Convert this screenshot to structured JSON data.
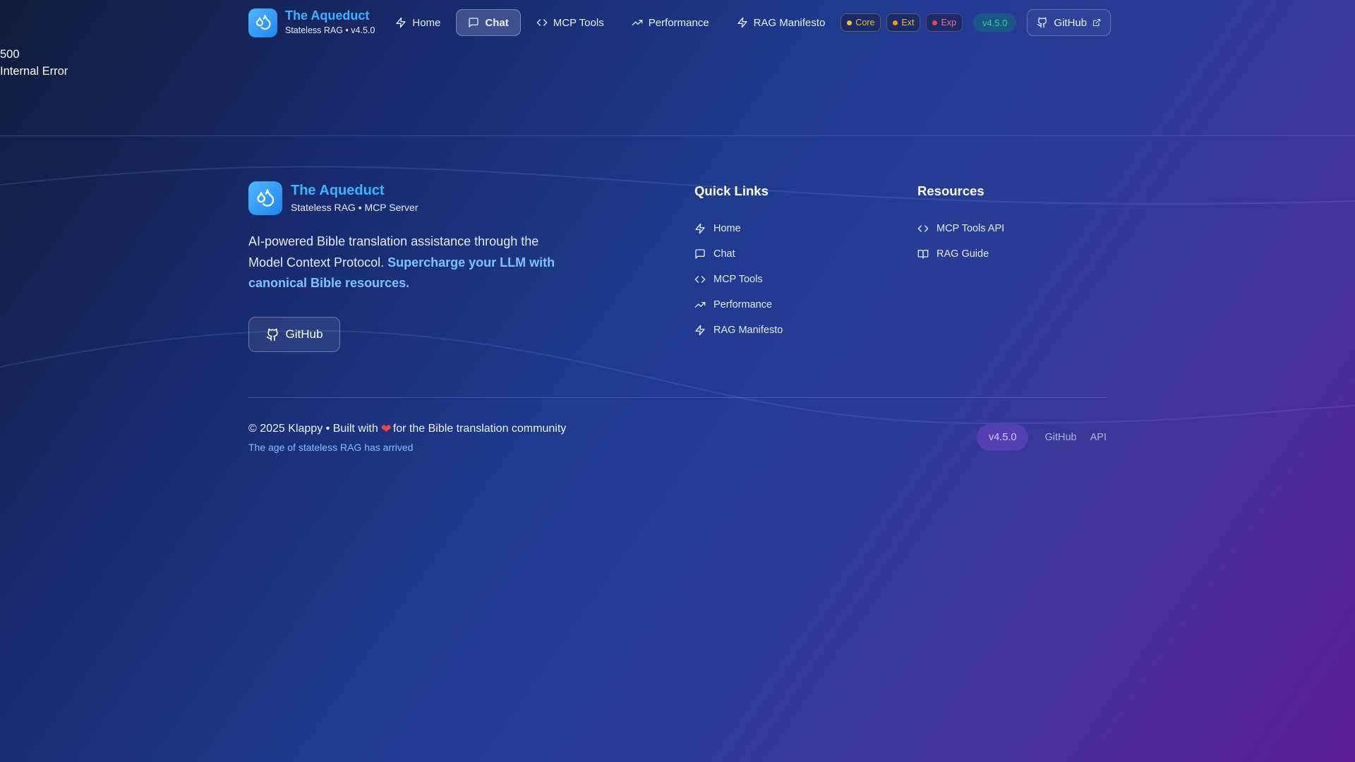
{
  "nav": {
    "brand_title": "The Aqueduct",
    "brand_sub": "Stateless RAG • v4.5.0",
    "items": [
      {
        "label": "Home",
        "icon": "bolt-icon"
      },
      {
        "label": "Chat",
        "icon": "chat-icon",
        "active": true
      },
      {
        "label": "MCP Tools",
        "icon": "code-icon"
      },
      {
        "label": "Performance",
        "icon": "trending-up-icon"
      },
      {
        "label": "RAG Manifesto",
        "icon": "bolt-icon"
      }
    ],
    "badges": {
      "core": "Core",
      "ext": "Ext",
      "exp": "Exp"
    },
    "version": "v4.5.0",
    "github": "GitHub"
  },
  "error": {
    "code": "500",
    "message": "Internal Error"
  },
  "footer": {
    "brand_title": "The Aqueduct",
    "brand_sub": "Stateless RAG • MCP Server",
    "desc_plain": "AI-powered Bible translation assistance through the Model Context Protocol.",
    "desc_highlight": "Supercharge your LLM with canonical Bible resources.",
    "github_button": "GitHub",
    "quick_links_title": "Quick Links",
    "quick_links": [
      {
        "label": "Home",
        "icon": "bolt-icon"
      },
      {
        "label": "Chat",
        "icon": "chat-icon"
      },
      {
        "label": "MCP Tools",
        "icon": "code-icon"
      },
      {
        "label": "Performance",
        "icon": "trending-up-icon"
      },
      {
        "label": "RAG Manifesto",
        "icon": "bolt-icon"
      }
    ],
    "resources_title": "Resources",
    "resources": [
      {
        "label": "MCP Tools API",
        "icon": "code-icon"
      },
      {
        "label": "RAG Guide",
        "icon": "book-icon"
      }
    ],
    "copyright_pre": "© 2025 Klappy • Built with",
    "copyright_post": "for the Bible translation community",
    "tagline": "The age of stateless RAG has arrived",
    "version": "v4.5.0",
    "link_github": "GitHub",
    "link_api": "API"
  },
  "colors": {
    "accent": "#38b6ff",
    "highlight": "#7cc3ff",
    "core": "#fbbf24",
    "exp": "#ef4444",
    "version_green": "#34d399"
  }
}
